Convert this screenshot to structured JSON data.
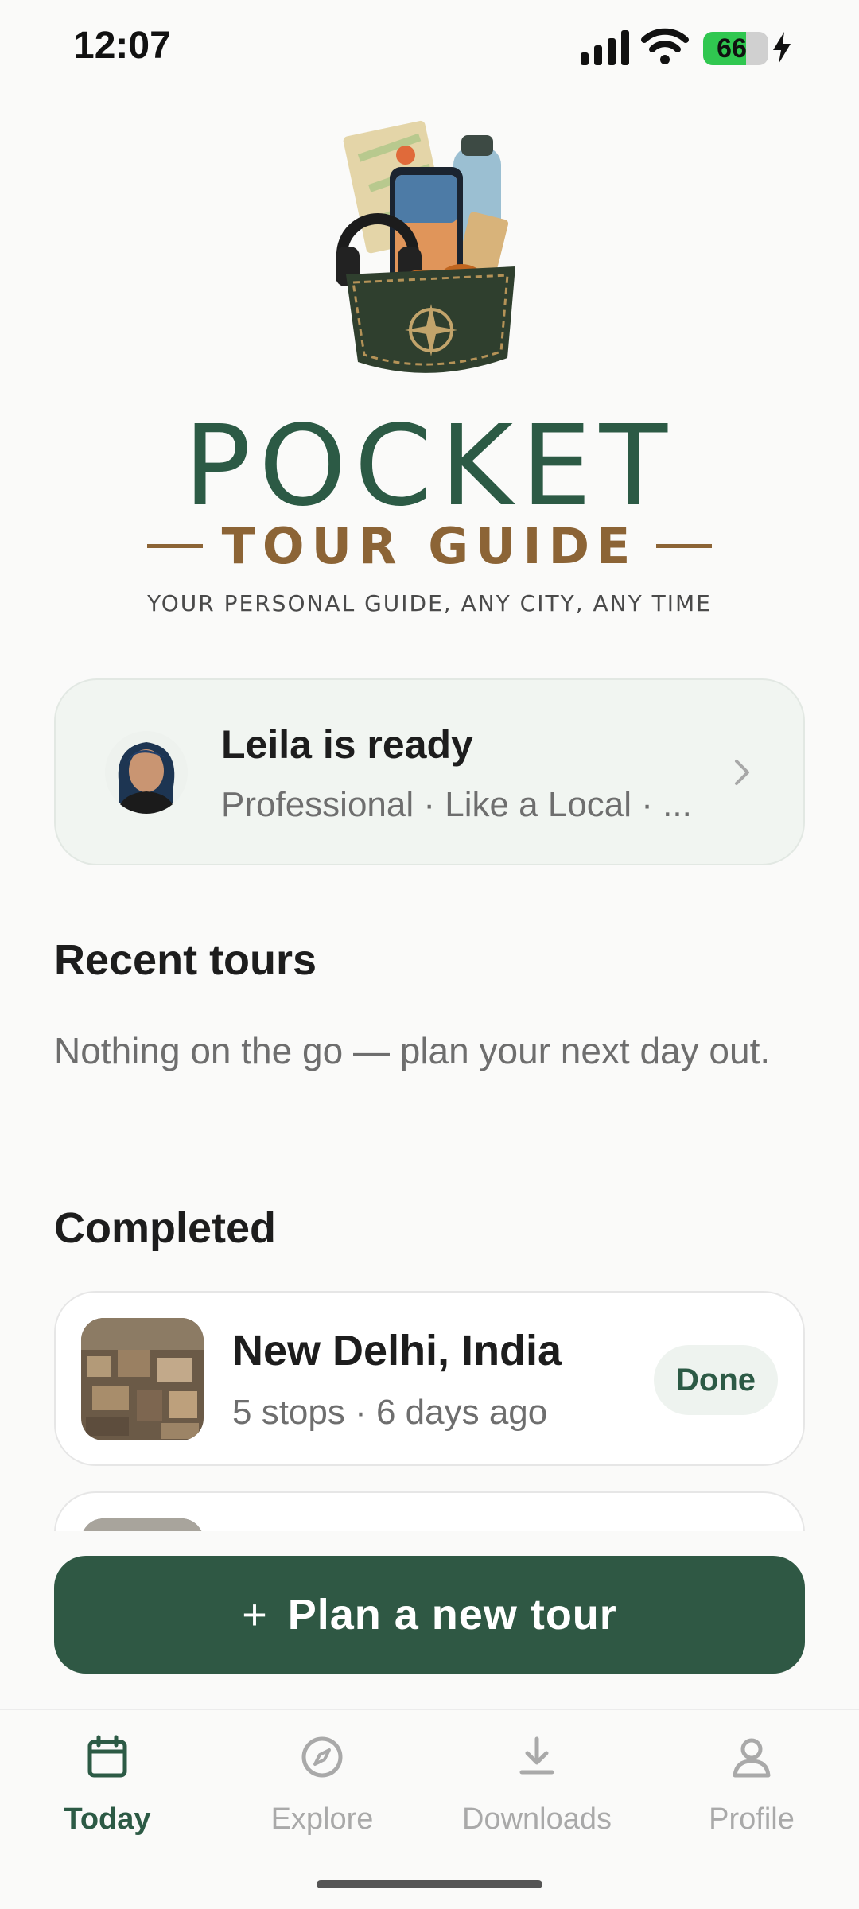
{
  "status_bar": {
    "time": "12:07",
    "battery_level": 66,
    "battery_text": "66",
    "signal_icon": "cellular-signal-icon",
    "wifi_icon": "wifi-icon",
    "charging_icon": "bolt-icon"
  },
  "brand": {
    "title": "POCKET",
    "subtitle": "TOUR GUIDE",
    "tagline": "YOUR PERSONAL GUIDE, ANY CITY, ANY TIME",
    "logo_icon": "pocket-travel-kit-logo"
  },
  "guide": {
    "name_line": "Leila is ready",
    "description": "Professional · Like a Local · ...",
    "avatar_icon": "guide-avatar",
    "chevron_icon": "chevron-right-icon"
  },
  "recent": {
    "title": "Recent tours",
    "empty_text": "Nothing on the go — plan your next day out."
  },
  "completed": {
    "title": "Completed",
    "tours": [
      {
        "name": "New Delhi, India",
        "meta": "5 stops · 6 days ago",
        "badge": "Done"
      }
    ]
  },
  "cta": {
    "plus": "+",
    "label": "Plan a new tour"
  },
  "nav": {
    "items": [
      {
        "label": "Today",
        "icon": "calendar-icon",
        "active": true
      },
      {
        "label": "Explore",
        "icon": "compass-icon",
        "active": false
      },
      {
        "label": "Downloads",
        "icon": "download-icon",
        "active": false
      },
      {
        "label": "Profile",
        "icon": "person-icon",
        "active": false
      }
    ]
  },
  "colors": {
    "brand_green": "#2c5a45",
    "cta_green": "#2f5844",
    "brand_brown": "#8c6436",
    "inactive_gray": "#a9a9a9",
    "battery_green": "#30c750"
  }
}
